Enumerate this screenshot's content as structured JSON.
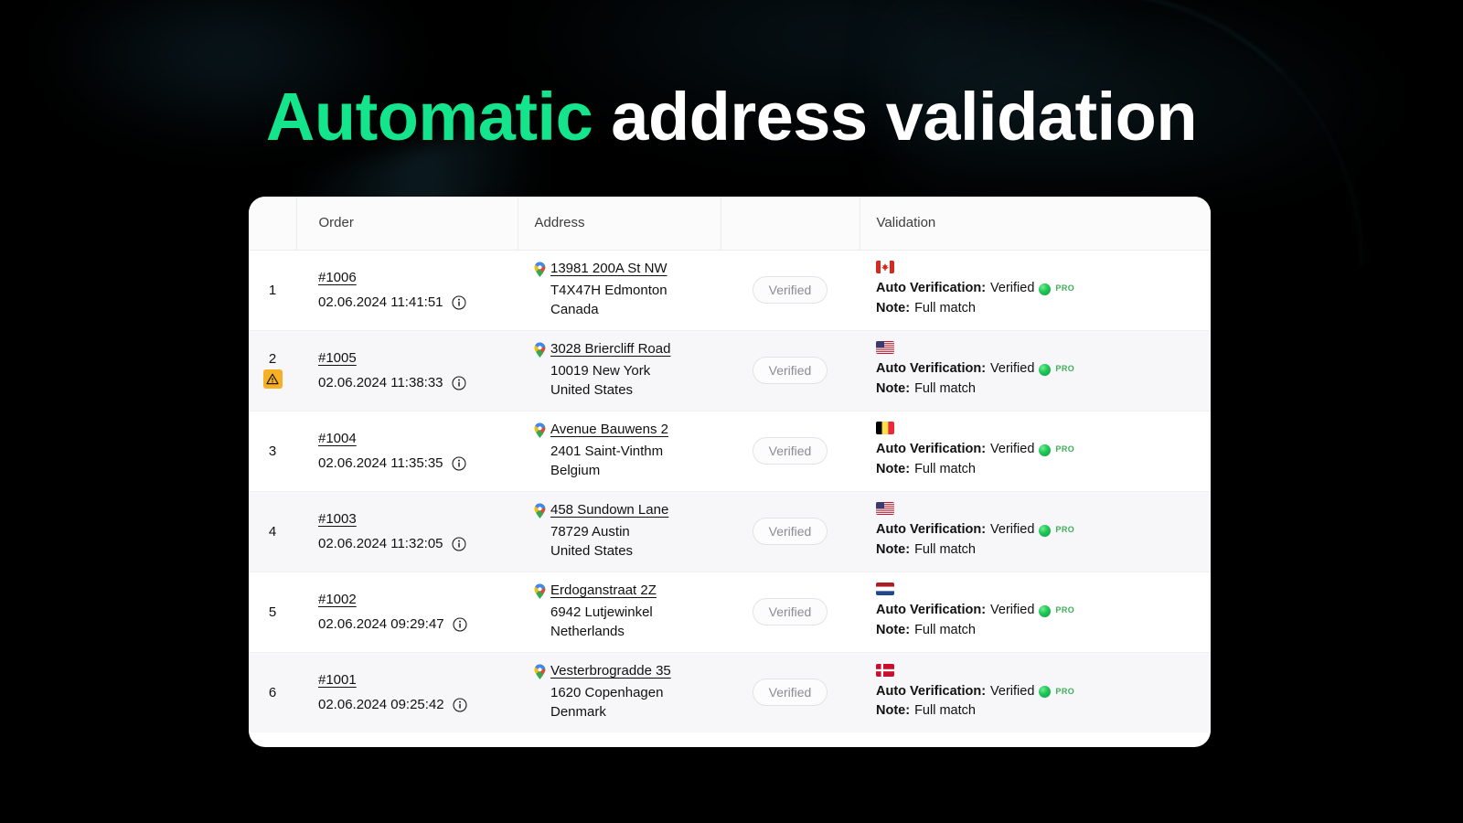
{
  "headline": {
    "accent_text": "Automatic",
    "rest_text": " address validation",
    "accent_color": "#14E58C"
  },
  "table": {
    "columns": [
      {
        "key": "num",
        "label": ""
      },
      {
        "key": "order",
        "label": "Order"
      },
      {
        "key": "address",
        "label": "Address"
      },
      {
        "key": "status",
        "label": ""
      },
      {
        "key": "validation",
        "label": "Validation"
      }
    ],
    "labels": {
      "auto_verification_label": "Auto Verification:",
      "auto_verification_value": "Verified",
      "note_label": "Note:",
      "note_value": "Full match",
      "pro_tag": "PRO",
      "verified_badge": "Verified"
    },
    "rows": [
      {
        "num": "1",
        "warning": false,
        "order_id": "#1006",
        "order_date": "02.06.2024 11:41:51",
        "street": "13981 200A St NW",
        "city": "T4X47H Edmonton",
        "country": "Canada",
        "status": "Verified",
        "flag": "canada-flag",
        "auto_verification": "Verified",
        "note": "Full match"
      },
      {
        "num": "2",
        "warning": true,
        "order_id": "#1005",
        "order_date": "02.06.2024 11:38:33",
        "street": "3028 Briercliff Road",
        "city": "10019 New York",
        "country": "United States",
        "status": "Verified",
        "flag": "united-states-flag",
        "auto_verification": "Verified",
        "note": "Full match"
      },
      {
        "num": "3",
        "warning": false,
        "order_id": "#1004",
        "order_date": "02.06.2024 11:35:35",
        "street": "Avenue Bauwens 2",
        "city": "2401 Saint-Vinthm",
        "country": "Belgium",
        "status": "Verified",
        "flag": "belgium-flag",
        "auto_verification": "Verified",
        "note": "Full match"
      },
      {
        "num": "4",
        "warning": false,
        "order_id": "#1003",
        "order_date": "02.06.2024 11:32:05",
        "street": "458 Sundown Lane",
        "city": "78729 Austin",
        "country": "United States",
        "status": "Verified",
        "flag": "united-states-flag",
        "auto_verification": "Verified",
        "note": "Full match"
      },
      {
        "num": "5",
        "warning": false,
        "order_id": "#1002",
        "order_date": "02.06.2024 09:29:47",
        "street": "Erdoganstraat 2Z",
        "city": "6942 Lutjewinkel",
        "country": "Netherlands",
        "status": "Verified",
        "flag": "netherlands-flag",
        "auto_verification": "Verified",
        "note": "Full match"
      },
      {
        "num": "6",
        "warning": false,
        "order_id": "#1001",
        "order_date": "02.06.2024 09:25:42",
        "street": "Vesterbrogradde 35",
        "city": "1620 Copenhagen",
        "country": "Denmark",
        "status": "Verified",
        "flag": "denmark-flag",
        "auto_verification": "Verified",
        "note": "Full match"
      }
    ]
  },
  "colors": {
    "background": "#000000",
    "card": "#ffffff",
    "accent_green": "#14E58C",
    "warning_amber": "#F7B023",
    "status_green": "#22C659"
  }
}
